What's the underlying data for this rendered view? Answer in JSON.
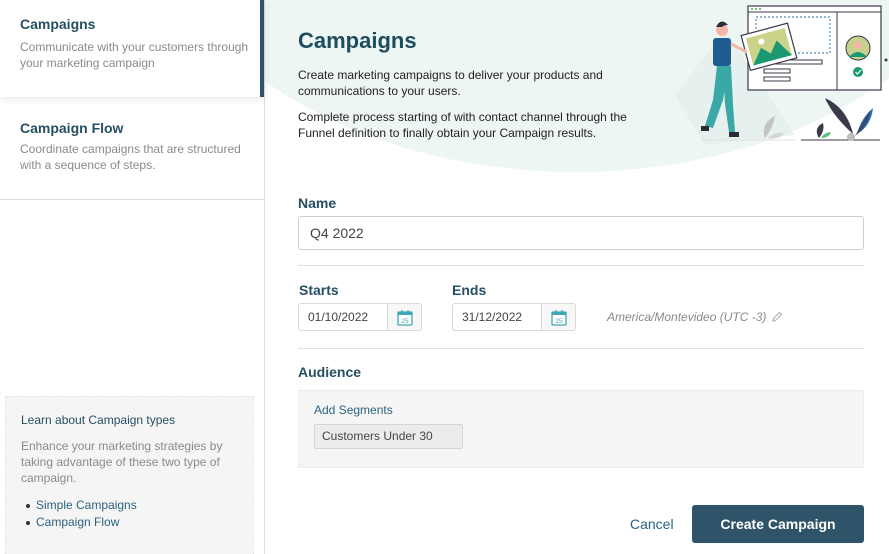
{
  "sidebar": {
    "items": [
      {
        "title": "Campaigns",
        "description": "Communicate with your customers through your marketing campaign",
        "active": true
      },
      {
        "title": "Campaign Flow",
        "description": "Coordinate campaigns that are structured with a sequence of steps.",
        "active": false
      }
    ],
    "learn": {
      "title": "Learn about Campaign types",
      "text": "Enhance your marketing strategies by taking advantage of these two type of campaign.",
      "links": [
        "Simple Campaigns",
        "Campaign Flow"
      ]
    }
  },
  "header": {
    "title": "Campaigns",
    "paragraph1": "Create marketing campaigns to deliver your products and communications to your users.",
    "paragraph2": "Complete process starting of with contact channel through the Funnel definition to finally obtain your Campaign results.",
    "illustration": "person-holding-image-illustration"
  },
  "form": {
    "name": {
      "label": "Name",
      "value": "Q4 2022"
    },
    "starts": {
      "label": "Starts",
      "value": "01/10/2022",
      "icon": "calendar-icon",
      "icon_day": "25"
    },
    "ends": {
      "label": "Ends",
      "value": "31/12/2022",
      "icon": "calendar-icon",
      "icon_day": "25"
    },
    "timezone": {
      "value": "America/Montevideo (UTC -3)",
      "icon": "pencil-icon"
    },
    "audience": {
      "label": "Audience",
      "add_segments_label": "Add Segments",
      "segments": [
        "Customers Under 30"
      ]
    }
  },
  "actions": {
    "cancel_label": "Cancel",
    "create_label": "Create Campaign"
  },
  "colors": {
    "primary": "#2f5469",
    "heading": "#274e63",
    "link": "#2d6381",
    "hero_bg": "#eef6f4",
    "calendar_accent": "#3fa7b4"
  }
}
